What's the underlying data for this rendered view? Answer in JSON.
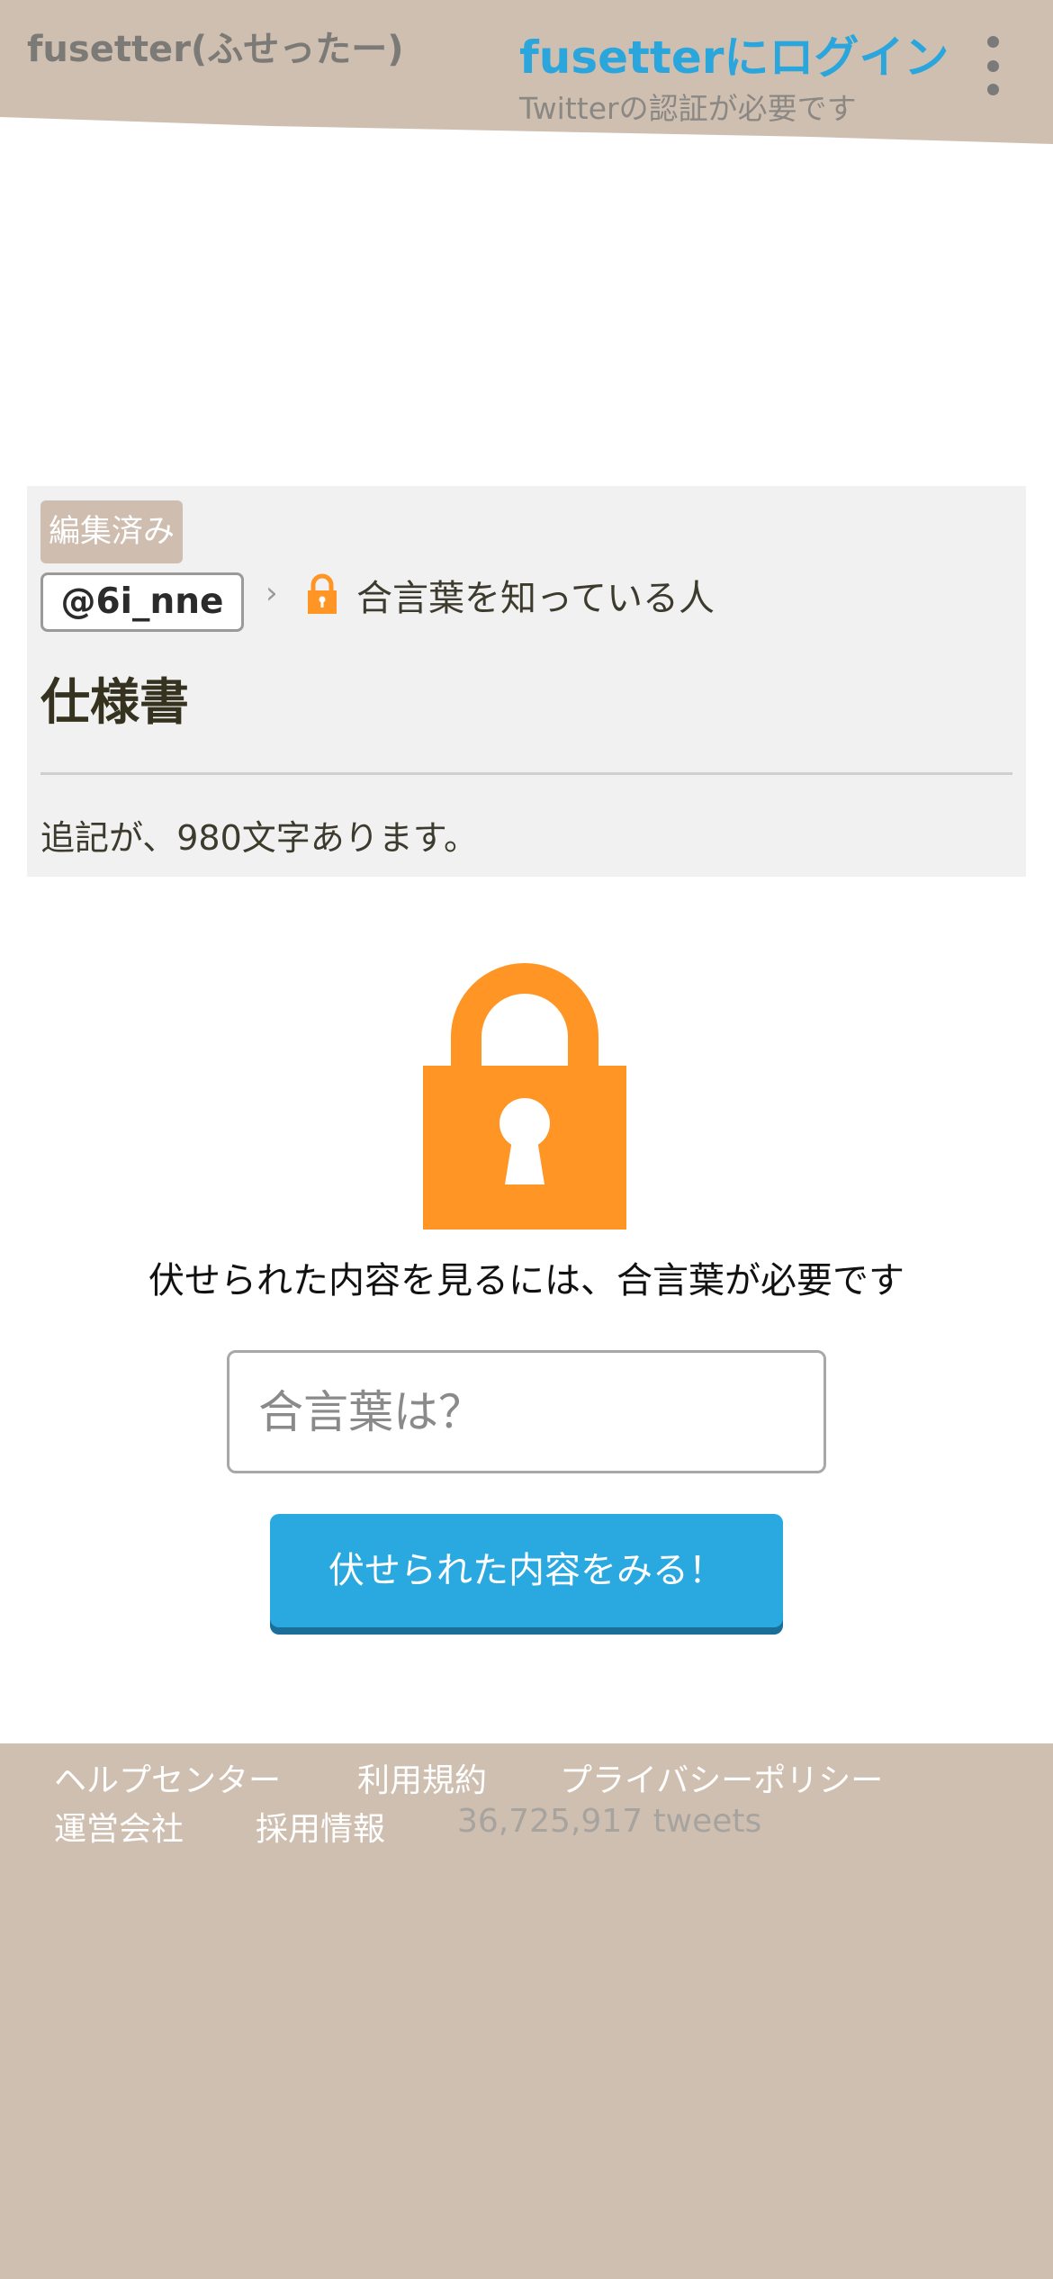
{
  "header": {
    "site_title": "fusetter(ふせったー)",
    "login_title": "fusetterにログイン",
    "login_subtitle": "Twitterの認証が必要です",
    "menu_icon": "more-vertical-icon",
    "background_color": "#cfbfb1"
  },
  "post": {
    "edited_badge": "編集済み",
    "username": "@6i_nne",
    "chevron": "›",
    "audience_icon": "lock-icon",
    "audience_label": "合言葉を知っている人",
    "title": "仕様書",
    "postscript_note": "追記が、980文字あります。"
  },
  "lock_section": {
    "icon": "padlock-icon",
    "icon_color": "#ff9524",
    "message": "伏せられた内容を見るには、合言葉が必要です",
    "password_placeholder": "合言葉は？",
    "password_value": "",
    "submit_label": "伏せられた内容をみる！",
    "button_color": "#2aa8e0"
  },
  "footer": {
    "links": [
      "ヘルプセンター",
      "利用規約",
      "プライバシーポリシー",
      "運営会社",
      "採用情報"
    ],
    "tweet_count": "36,725,917 tweets",
    "background_color": "#cfbfb1"
  }
}
